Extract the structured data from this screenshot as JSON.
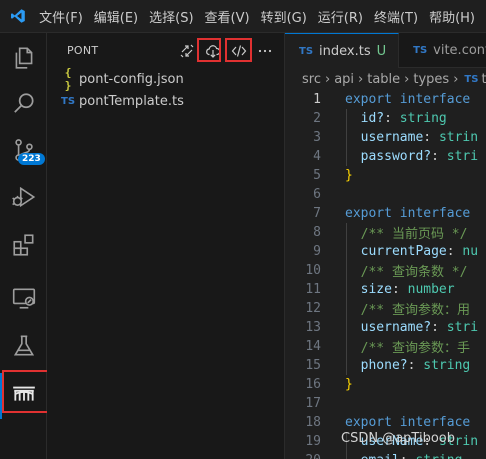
{
  "menu": [
    "文件(F)",
    "编辑(E)",
    "选择(S)",
    "查看(V)",
    "转到(G)",
    "运行(R)",
    "终端(T)",
    "帮助(H)"
  ],
  "activity_bar": {
    "items": [
      "explorer-icon",
      "search-icon",
      "source-control-icon",
      "run-debug-icon",
      "extensions-icon",
      "remote-explorer-icon",
      "testing-icon",
      "pont-icon"
    ],
    "source_control_badge": "223"
  },
  "sidebar": {
    "title": "PONT",
    "actions": [
      "sync-icon",
      "cloud-download-icon",
      "code-icon",
      "more-icon"
    ],
    "files": [
      {
        "icon": "{ }",
        "name": "pont-config.json"
      },
      {
        "icon": "TS",
        "name": "pontTemplate.ts"
      }
    ]
  },
  "editor": {
    "tabs": [
      {
        "icon": "TS",
        "name": "index.ts",
        "status": "U",
        "active": true
      },
      {
        "icon": "TS",
        "name": "vite.conf",
        "active": false
      }
    ],
    "breadcrumb": [
      "src",
      "api",
      "table",
      "types",
      "t"
    ],
    "breadcrumb_ts": "TS",
    "current_line": 1,
    "lines": [
      {
        "n": "1",
        "tokens": [
          [
            "kw",
            "export "
          ],
          [
            "kw",
            "interface"
          ]
        ]
      },
      {
        "n": "2",
        "tokens": [
          [
            "prop",
            "  id?"
          ],
          [
            "punc",
            ": "
          ],
          [
            "type",
            "string"
          ]
        ]
      },
      {
        "n": "3",
        "tokens": [
          [
            "prop",
            "  username"
          ],
          [
            "punc",
            ": "
          ],
          [
            "type",
            "strin"
          ]
        ]
      },
      {
        "n": "4",
        "tokens": [
          [
            "prop",
            "  password?"
          ],
          [
            "punc",
            ": "
          ],
          [
            "type",
            "stri"
          ]
        ]
      },
      {
        "n": "5",
        "tokens": [
          [
            "brace",
            "}"
          ]
        ]
      },
      {
        "n": "6",
        "tokens": []
      },
      {
        "n": "7",
        "tokens": [
          [
            "kw",
            "export "
          ],
          [
            "kw",
            "interface"
          ]
        ]
      },
      {
        "n": "8",
        "tokens": [
          [
            "cmt",
            "  /** 当前页码 */"
          ]
        ]
      },
      {
        "n": "9",
        "tokens": [
          [
            "prop",
            "  currentPage"
          ],
          [
            "punc",
            ": "
          ],
          [
            "type",
            "nu"
          ]
        ]
      },
      {
        "n": "10",
        "tokens": [
          [
            "cmt",
            "  /** 查询条数 */"
          ]
        ]
      },
      {
        "n": "11",
        "tokens": [
          [
            "prop",
            "  size"
          ],
          [
            "punc",
            ": "
          ],
          [
            "type",
            "number"
          ]
        ]
      },
      {
        "n": "12",
        "tokens": [
          [
            "cmt",
            "  /** 查询参数：用"
          ]
        ]
      },
      {
        "n": "13",
        "tokens": [
          [
            "prop",
            "  username?"
          ],
          [
            "punc",
            ": "
          ],
          [
            "type",
            "stri"
          ]
        ]
      },
      {
        "n": "14",
        "tokens": [
          [
            "cmt",
            "  /** 查询参数：手"
          ]
        ]
      },
      {
        "n": "15",
        "tokens": [
          [
            "prop",
            "  phone?"
          ],
          [
            "punc",
            ": "
          ],
          [
            "type",
            "string"
          ]
        ]
      },
      {
        "n": "16",
        "tokens": [
          [
            "brace",
            "}"
          ]
        ]
      },
      {
        "n": "17",
        "tokens": []
      },
      {
        "n": "18",
        "tokens": [
          [
            "kw",
            "export "
          ],
          [
            "kw",
            "interface"
          ]
        ]
      },
      {
        "n": "19",
        "tokens": [
          [
            "prop",
            "  userName"
          ],
          [
            "punc",
            ": "
          ],
          [
            "type",
            "strin"
          ]
        ]
      },
      {
        "n": "20",
        "tokens": [
          [
            "prop",
            "  email"
          ],
          [
            "punc",
            ": "
          ],
          [
            "type",
            "string"
          ]
        ]
      }
    ]
  },
  "watermark": "CSDN @apTiboob"
}
